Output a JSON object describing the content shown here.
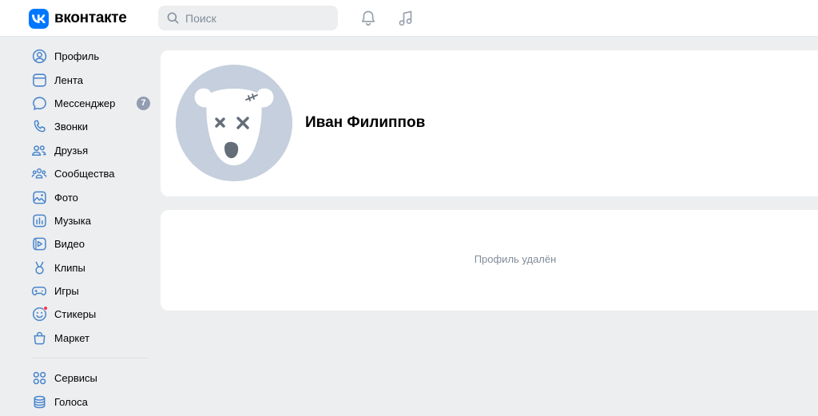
{
  "header": {
    "logo_text": "вконтакте",
    "search_placeholder": "Поиск",
    "icons": [
      "notifications-icon",
      "music-icon"
    ]
  },
  "sidebar": {
    "items": [
      {
        "label": "Профиль",
        "icon": "profile-icon"
      },
      {
        "label": "Лента",
        "icon": "feed-icon"
      },
      {
        "label": "Мессенджер",
        "icon": "messenger-icon",
        "badge": "7"
      },
      {
        "label": "Звонки",
        "icon": "calls-icon"
      },
      {
        "label": "Друзья",
        "icon": "friends-icon"
      },
      {
        "label": "Сообщества",
        "icon": "communities-icon"
      },
      {
        "label": "Фото",
        "icon": "photo-icon"
      },
      {
        "label": "Музыка",
        "icon": "music-icon"
      },
      {
        "label": "Видео",
        "icon": "video-icon"
      },
      {
        "label": "Клипы",
        "icon": "clips-icon"
      },
      {
        "label": "Игры",
        "icon": "games-icon"
      },
      {
        "label": "Стикеры",
        "icon": "stickers-icon",
        "has_dot": true
      },
      {
        "label": "Маркет",
        "icon": "market-icon"
      }
    ],
    "secondary_items": [
      {
        "label": "Сервисы",
        "icon": "services-icon"
      },
      {
        "label": "Голоса",
        "icon": "votes-icon"
      }
    ]
  },
  "profile": {
    "name": "Иван Филиппов",
    "deleted_message": "Профиль удалён"
  },
  "colors": {
    "accent": "#0077ff",
    "background": "#edeef0",
    "card": "#ffffff",
    "icon": "#4986cc",
    "secondary_text": "#818c99",
    "badge": "#939cb0",
    "notification_dot": "#ff3347",
    "avatar_bg": "#c5cfdd"
  }
}
